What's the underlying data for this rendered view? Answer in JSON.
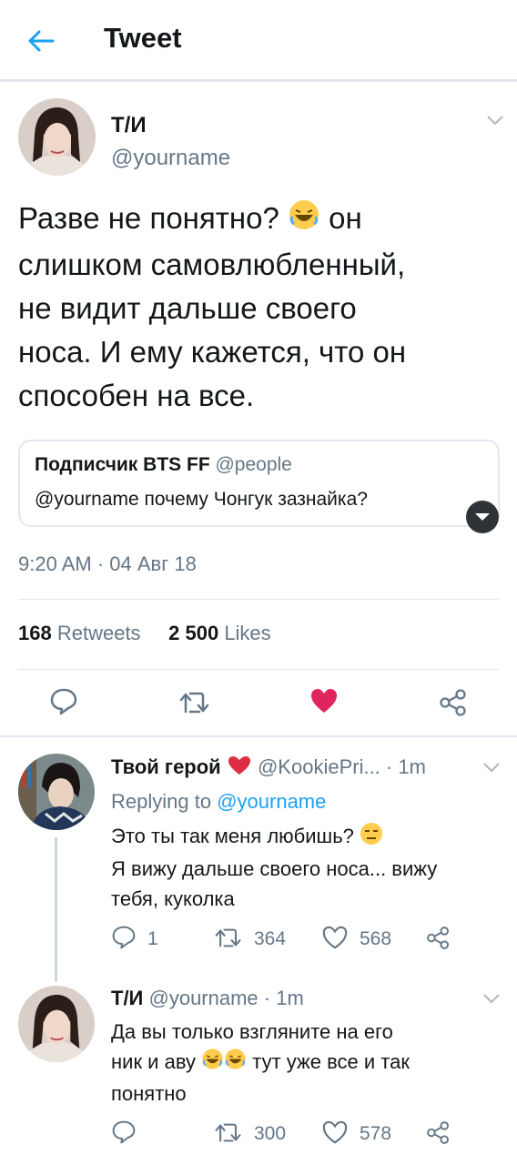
{
  "header": {
    "title": "Tweet"
  },
  "main_tweet": {
    "name": "Т/И",
    "handle": "@yourname",
    "text_line1a": "Разве не понятно?",
    "text_line1b": "он",
    "text_line2": "слишком самовлюбленный,",
    "text_line3": "не видит дальше своего",
    "text_line4": "носа. И ему кажется, что он",
    "text_line5": "способен на все.",
    "quote": {
      "name": "Подписчик BTS FF",
      "handle": "@people",
      "text": "@yourname почему Чонгук зазнайка?"
    },
    "time": "9:20 AM · 04 Авг 18",
    "retweets_count": "168",
    "retweets_label": "Retweets",
    "likes_count": "2 500",
    "likes_label": "Likes"
  },
  "reply1": {
    "name": "Твой герой",
    "handle": "@KookiePri...",
    "time": "· 1m",
    "replying_prefix": "Replying to",
    "replying_handle": "@yourname",
    "text_line1": "Это ты так меня любишь?",
    "text_line2": "Я вижу дальше своего носа... вижу",
    "text_line3": "тебя, куколка",
    "replies": "1",
    "retweets": "364",
    "likes": "568"
  },
  "reply2": {
    "name": "Т/И",
    "handle": "@yourname",
    "time": "· 1m",
    "text_line1": "Да вы только взгляните на его",
    "text_line2a": "ник и аву",
    "text_line2b": "тут уже все и так",
    "text_line3": "понятно",
    "retweets": "300",
    "likes": "578"
  },
  "colors": {
    "accent": "#1da1f2",
    "like": "#e0245e",
    "muted": "#657786",
    "border": "#e1e8ed"
  },
  "icons": [
    "back-arrow-icon",
    "chevron-down-icon",
    "reply-icon",
    "retweet-icon",
    "heart-icon",
    "share-icon",
    "laughing-emoji-icon",
    "expressionless-emoji-icon",
    "red-heart-emoji-icon"
  ]
}
